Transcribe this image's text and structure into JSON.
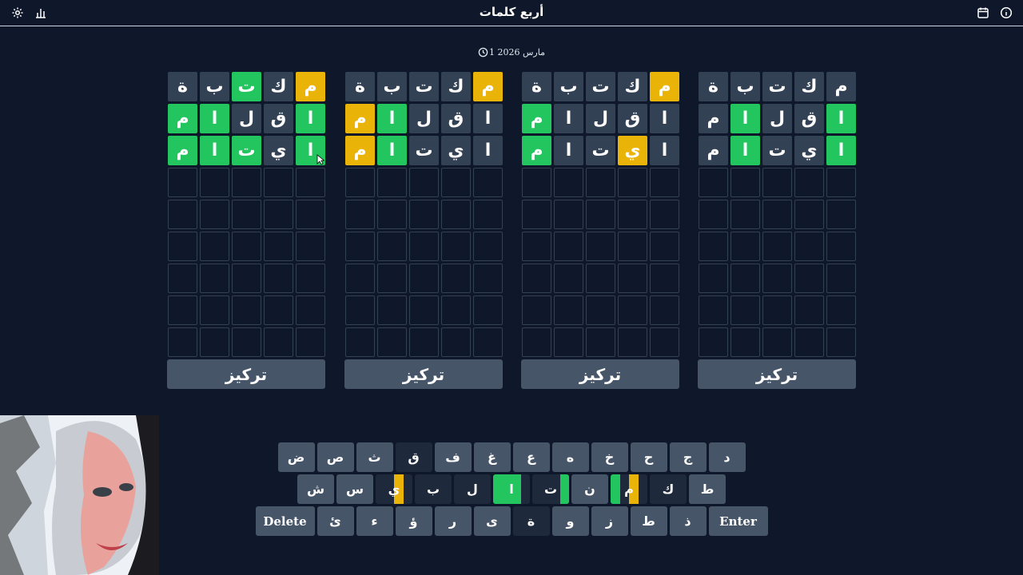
{
  "header": {
    "title": "أربع كلمات"
  },
  "date": "1 مارس 2026",
  "boards": [
    {
      "rows": [
        {
          "letters": [
            "م",
            "ك",
            "ت",
            "ب",
            "ة"
          ],
          "states": [
            "n",
            "n",
            "n",
            "n",
            "n"
          ]
        },
        {
          "letters": [
            "ا",
            "ق",
            "ل",
            "ا",
            "م"
          ],
          "states": [
            "g",
            "n",
            "n",
            "g",
            "n"
          ]
        },
        {
          "letters": [
            "ا",
            "ي",
            "ت",
            "ا",
            "م"
          ],
          "states": [
            "g",
            "n",
            "n",
            "g",
            "n"
          ]
        }
      ],
      "focus_label": "تركيز"
    },
    {
      "rows": [
        {
          "letters": [
            "م",
            "ك",
            "ت",
            "ب",
            "ة"
          ],
          "states": [
            "y",
            "n",
            "n",
            "n",
            "n"
          ]
        },
        {
          "letters": [
            "ا",
            "ق",
            "ل",
            "ا",
            "م"
          ],
          "states": [
            "n",
            "n",
            "n",
            "n",
            "g"
          ]
        },
        {
          "letters": [
            "ا",
            "ي",
            "ت",
            "ا",
            "م"
          ],
          "states": [
            "n",
            "y",
            "n",
            "n",
            "g"
          ]
        }
      ],
      "focus_label": "تركيز"
    },
    {
      "rows": [
        {
          "letters": [
            "م",
            "ك",
            "ت",
            "ب",
            "ة"
          ],
          "states": [
            "y",
            "n",
            "n",
            "n",
            "n"
          ]
        },
        {
          "letters": [
            "ا",
            "ق",
            "ل",
            "ا",
            "م"
          ],
          "states": [
            "n",
            "n",
            "n",
            "g",
            "y"
          ]
        },
        {
          "letters": [
            "ا",
            "ي",
            "ت",
            "ا",
            "م"
          ],
          "states": [
            "n",
            "n",
            "n",
            "g",
            "y"
          ]
        }
      ],
      "focus_label": "تركيز"
    },
    {
      "rows": [
        {
          "letters": [
            "م",
            "ك",
            "ت",
            "ب",
            "ة"
          ],
          "states": [
            "y",
            "n",
            "g",
            "n",
            "n"
          ]
        },
        {
          "letters": [
            "ا",
            "ق",
            "ل",
            "ا",
            "م"
          ],
          "states": [
            "g",
            "n",
            "n",
            "g",
            "g"
          ]
        },
        {
          "letters": [
            "ا",
            "ي",
            "ت",
            "ا",
            "م"
          ],
          "states": [
            "g",
            "n",
            "g",
            "g",
            "g"
          ]
        }
      ],
      "focus_label": "تركيز"
    }
  ],
  "keyboard": {
    "row1": [
      {
        "label": "د"
      },
      {
        "label": "ج"
      },
      {
        "label": "ح"
      },
      {
        "label": "خ"
      },
      {
        "label": "ه"
      },
      {
        "label": "ع"
      },
      {
        "label": "غ"
      },
      {
        "label": "ف"
      },
      {
        "label": "ق",
        "used": true
      },
      {
        "label": "ث"
      },
      {
        "label": "ص"
      },
      {
        "label": "ض"
      }
    ],
    "row2": [
      {
        "label": "ط"
      },
      {
        "label": "ك",
        "used": true
      },
      {
        "label": "م",
        "used": true,
        "quads": [
          "n",
          "y",
          "n",
          "g"
        ]
      },
      {
        "label": "ن"
      },
      {
        "label": "ت",
        "used": true,
        "quads": [
          "g",
          "n",
          "n",
          "n"
        ]
      },
      {
        "label": "ا",
        "used": true,
        "quads": [
          "n",
          "g",
          "g",
          "g"
        ]
      },
      {
        "label": "ل",
        "used": true
      },
      {
        "label": "ب",
        "used": true
      },
      {
        "label": "ي",
        "used": true,
        "quads": [
          "n",
          "y",
          "n",
          "n"
        ]
      },
      {
        "label": "س"
      },
      {
        "label": "ش"
      }
    ],
    "row3": [
      {
        "label": "Enter",
        "wide": true
      },
      {
        "label": "ذ"
      },
      {
        "label": "ط"
      },
      {
        "label": "ز"
      },
      {
        "label": "و"
      },
      {
        "label": "ة",
        "used": true
      },
      {
        "label": "ى"
      },
      {
        "label": "ر"
      },
      {
        "label": "ؤ"
      },
      {
        "label": "ء"
      },
      {
        "label": "ئ"
      },
      {
        "label": "Delete",
        "wide": true
      }
    ]
  },
  "colors": {
    "background": "#0f172a",
    "correct": "#22c55e",
    "present": "#eab308",
    "tile": "#334155",
    "key": "#475569"
  },
  "icons": [
    "settings-icon",
    "stats-icon",
    "calendar-icon",
    "info-icon",
    "clock-icon"
  ]
}
